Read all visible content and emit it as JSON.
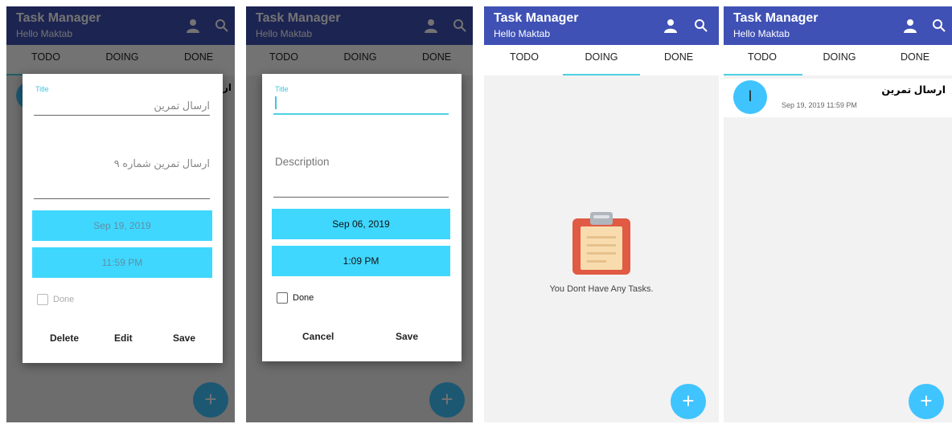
{
  "colors": {
    "appbar": "#3f51b5",
    "accent": "#40d7ff",
    "indicator": "#4dd0e1"
  },
  "icons": {
    "user": "person-icon",
    "search": "search-icon",
    "fab": "plus-icon",
    "empty": "clipboard-icon"
  },
  "app": {
    "title": "Task Manager",
    "subtitle": "Hello Maktab"
  },
  "tabs": [
    "TODO",
    "DOING",
    "DONE"
  ],
  "fab_label": "+",
  "screen1": {
    "active_tab": "TODO",
    "background_item_title": "ار",
    "dialog": {
      "title_label": "Title",
      "title_value": "ارسال تمرین",
      "description_value": "ارسال تمرین شماره ۹",
      "date": "Sep 19, 2019",
      "time": "11:59 PM",
      "done_label": "Done",
      "done_checked": false,
      "actions": {
        "delete": "Delete",
        "edit": "Edit",
        "save": "Save"
      }
    }
  },
  "screen2": {
    "active_tab": "DOING",
    "dialog": {
      "title_label": "Title",
      "title_value": "",
      "description_placeholder": "Description",
      "date": "Sep 06, 2019",
      "time": "1:09 PM",
      "done_label": "Done",
      "done_checked": false,
      "actions": {
        "cancel": "Cancel",
        "save": "Save"
      }
    }
  },
  "screen3": {
    "active_tab": "DOING",
    "empty_message": "You Dont Have Any Tasks."
  },
  "screen4": {
    "active_tab": "TODO",
    "tasks": [
      {
        "initial": "ا",
        "title": "ارسال تمرین",
        "datetime": "Sep 19, 2019 11:59 PM"
      }
    ]
  }
}
